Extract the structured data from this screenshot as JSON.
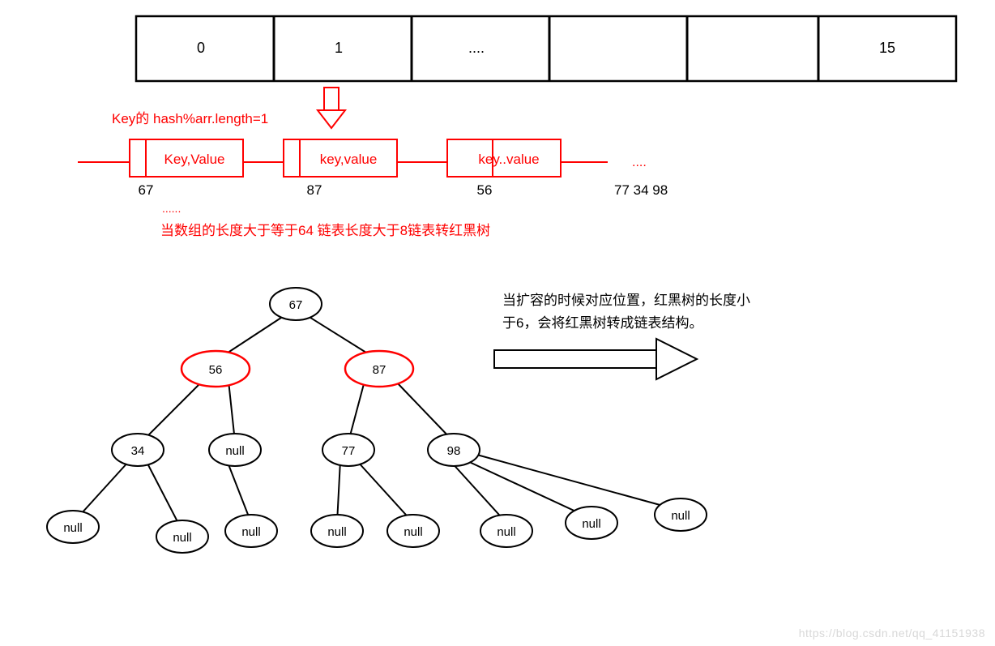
{
  "array": {
    "cells": [
      "0",
      "1",
      "....",
      "",
      "",
      "15"
    ]
  },
  "hash_label": "Key的 hash%arr.length=1",
  "linked_list": {
    "nodes": [
      {
        "label": "Key,Value",
        "below": "67"
      },
      {
        "label": "key,value",
        "below": "87"
      },
      {
        "label": "key..value",
        "below": "56"
      }
    ],
    "tail_dots": "....",
    "tail_numbers": "77 34   98",
    "ellipsis_small": "......"
  },
  "treeify_note": "当数组的长度大于等于64 链表长度大于8链表转红黑树",
  "untreeify_note_line1": "当扩容的时候对应位置，红黑树的长度小",
  "untreeify_note_line2": "于6，会将红黑树转成链表结构。",
  "tree": {
    "root": "67",
    "level2": {
      "left": "56",
      "right": "87"
    },
    "level3": [
      "34",
      "null",
      "77",
      "98"
    ],
    "leaves": [
      "null",
      "null",
      "null",
      "null",
      "null",
      "null",
      "null",
      "null"
    ]
  },
  "watermark": "https://blog.csdn.net/qq_41151938"
}
